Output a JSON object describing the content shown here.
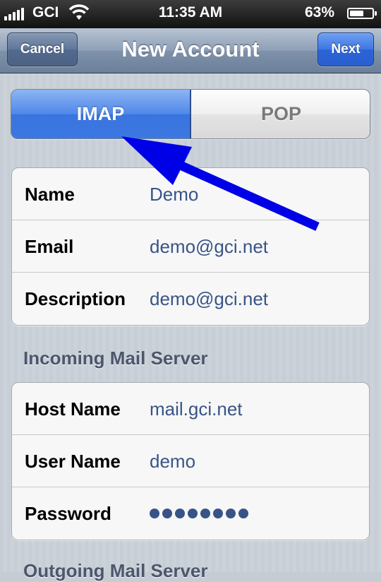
{
  "status_bar": {
    "carrier": "GCI",
    "time": "11:35 AM",
    "battery_pct": "63%",
    "battery_level": 0.63,
    "signal_bars": 5,
    "icons": [
      "signal-icon",
      "wifi-icon",
      "battery-icon"
    ]
  },
  "nav": {
    "title": "New Account",
    "cancel_label": "Cancel",
    "next_label": "Next"
  },
  "segmented": {
    "options": [
      "IMAP",
      "POP"
    ],
    "selected": "IMAP"
  },
  "account": {
    "rows": [
      {
        "label": "Name",
        "value": "Demo"
      },
      {
        "label": "Email",
        "value": "demo@gci.net"
      },
      {
        "label": "Description",
        "value": "demo@gci.net"
      }
    ]
  },
  "incoming": {
    "header": "Incoming Mail Server",
    "rows": [
      {
        "label": "Host Name",
        "value": "mail.gci.net"
      },
      {
        "label": "User Name",
        "value": "demo"
      },
      {
        "label": "Password",
        "value": "••••••••"
      }
    ],
    "password_length": 8
  },
  "outgoing": {
    "header": "Outgoing Mail Server"
  },
  "annotation": {
    "arrow_color": "#0000e6"
  },
  "colors": {
    "value_text": "#385487",
    "selected_segment": "#3a74df",
    "next_button": "#2b63d6"
  }
}
